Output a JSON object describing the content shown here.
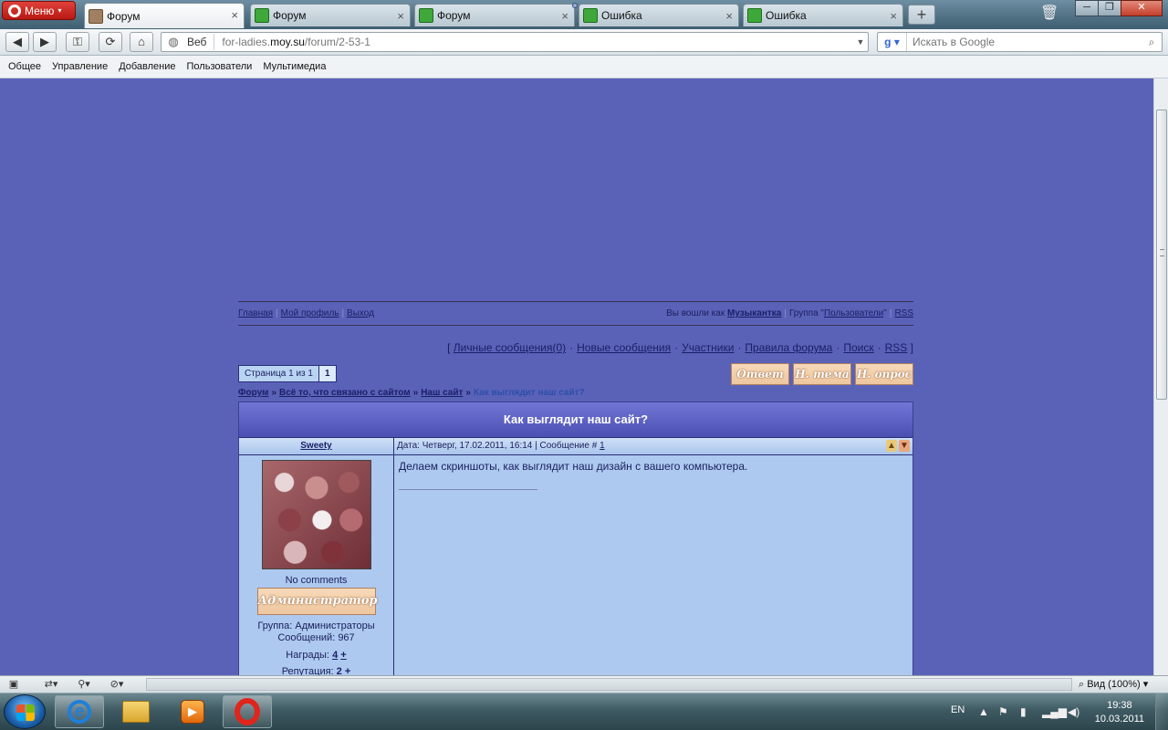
{
  "browser": {
    "menu_label": "Меню",
    "tabs": [
      {
        "label": "Форум",
        "active": true
      },
      {
        "label": "Форум",
        "active": false
      },
      {
        "label": "Форум",
        "active": false
      },
      {
        "label": "Ошибка",
        "active": false
      },
      {
        "label": "Ошибка",
        "active": false
      }
    ],
    "address": {
      "web_label": "Веб",
      "url_prefix": "for-ladies.",
      "url_domain": "moy.su",
      "url_path": "/forum/2-53-1"
    },
    "search": {
      "placeholder": "Искать в Google"
    },
    "bookmarks": [
      "Общее",
      "Управление",
      "Добавление",
      "Пользователи",
      "Мультимедиа"
    ]
  },
  "page": {
    "userbar": {
      "home": "Главная",
      "profile": "Мой профиль",
      "logout": "Выход",
      "logged_as": "Вы вошли как",
      "username": "Музыкантка",
      "group_prefix": "Группа \"",
      "group": "Пользователи",
      "group_suffix": "\"",
      "rss": "RSS"
    },
    "links": {
      "open": "[",
      "pm": "Личные сообщения(0)",
      "new": "Новые сообщения",
      "members": "Участники",
      "rules": "Правила форума",
      "search": "Поиск",
      "rss": "RSS",
      "close": "]"
    },
    "pager": {
      "text": "Страница 1 из 1",
      "current": "1"
    },
    "actions": {
      "reply": "Ответ",
      "new_topic": "Н. тема",
      "new_poll": "Н. опрос"
    },
    "breadcrumb": {
      "forum": "Форум",
      "section": "Всё то, что связано с сайтом",
      "subforum": "Наш сайт",
      "current": "Как выглядит наш сайт?"
    },
    "thread": {
      "title": "Как выглядит наш сайт?",
      "post": {
        "author": "Sweety",
        "meta_prefix": "Дата: Четверг, 17.02.2011, 16:14 | Сообщение #",
        "number": "1",
        "text": "Делаем скриншоты, как выглядит наш дизайн с вашего компьютера.",
        "status": "No comments",
        "rank": "Администратор",
        "group": "Группа: Администраторы",
        "messages": "Сообщений: 967",
        "awards_label": "Награды:",
        "awards_value": "4",
        "reputation_label": "Репутация:",
        "reputation_value": "2",
        "plus": "+"
      }
    }
  },
  "statusbar": {
    "zoom": "Вид (100%)"
  },
  "taskbar": {
    "lang": "EN",
    "time": "19:38",
    "date": "10.03.2011"
  }
}
